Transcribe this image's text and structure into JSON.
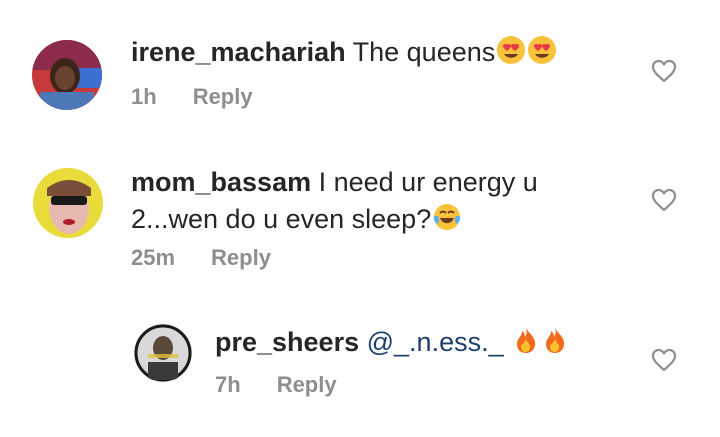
{
  "comments": [
    {
      "username": "irene_machariah",
      "text": "The queens",
      "emojis": [
        "heart-eyes-emoji",
        "heart-eyes-emoji"
      ],
      "time": "1h",
      "reply_label": "Reply",
      "like_icon": "heart-outline-icon"
    },
    {
      "username": "mom_bassam",
      "text_line1": "I need ur energy u",
      "text_line2": "2...wen do u even sleep?",
      "emojis": [
        "tears-of-joy-emoji"
      ],
      "time": "25m",
      "reply_label": "Reply",
      "like_icon": "heart-outline-icon"
    },
    {
      "username": "pre_sheers",
      "mention": "@_.n.ess._",
      "emojis": [
        "fire-emoji",
        "fire-emoji"
      ],
      "time": "7h",
      "reply_label": "Reply",
      "like_icon": "heart-outline-icon"
    }
  ],
  "colors": {
    "text": "#262626",
    "meta": "#8e8e8e",
    "mention": "#1d3f6e"
  }
}
